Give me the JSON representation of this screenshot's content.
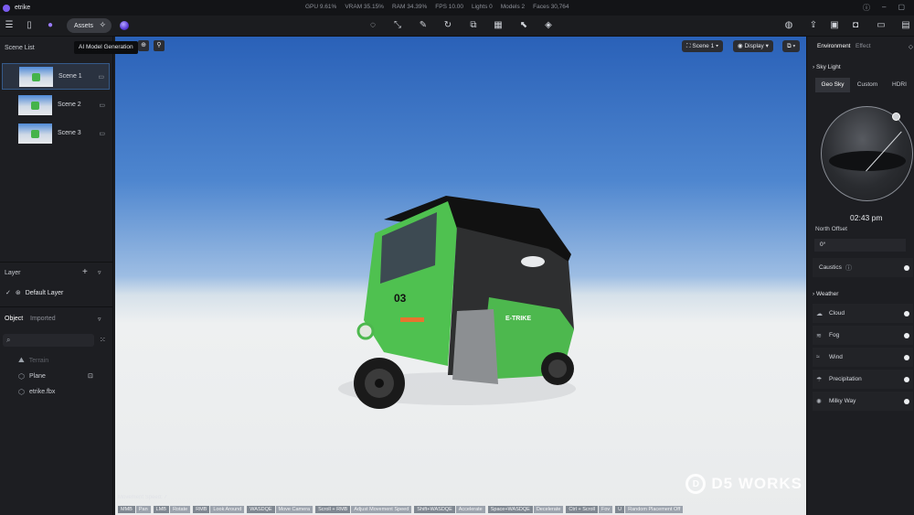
{
  "app": {
    "title": "etrike"
  },
  "stats": [
    "GPU 9.61%",
    "VRAM 35.15%",
    "RAM 34.39%",
    "FPS 10.00",
    "Lights 0",
    "Models 2",
    "Faces 30,764"
  ],
  "toolbar": {
    "assets_label": "Assets",
    "tooltip": "AI Model Generation"
  },
  "left_panel": {
    "scene_list_title": "Scene List",
    "scenes": [
      {
        "label": "Scene 1"
      },
      {
        "label": "Scene 2"
      },
      {
        "label": "Scene 3"
      }
    ],
    "layer_title": "Layer",
    "default_layer": "Default Layer",
    "object_tab": "Object",
    "imported_tab": "Imported",
    "objects": [
      {
        "label": "Terrain"
      },
      {
        "label": "Plane"
      },
      {
        "label": "etrike.fbx"
      }
    ]
  },
  "viewport": {
    "scene_selector": "Scene 1",
    "display_label": "Display",
    "movement_speed": "Movement Speed: 7",
    "shortcuts": [
      {
        "key": "MMB",
        "action": "Pan"
      },
      {
        "key": "LMB",
        "action": "Rotate"
      },
      {
        "key": "RMB",
        "action": "Look Around"
      },
      {
        "key": "WASDQE",
        "action": "Move Camera"
      },
      {
        "key": "Scroll + RMB",
        "action": "Adjust Movement Speed"
      },
      {
        "key": "Shift+WASDQE",
        "action": "Accelerate"
      },
      {
        "key": "Space+WASDQE",
        "action": "Decelerate"
      },
      {
        "key": "Ctrl + Scroll",
        "action": "Fov"
      },
      {
        "key": "U",
        "action": "Random Placement Off"
      }
    ],
    "vehicle_plate": "03",
    "vehicle_brand": "E-TRIKE",
    "watermark": "D5 WORKS"
  },
  "right_panel": {
    "tabs": [
      "Environment",
      "Effect"
    ],
    "sky_light_title": "Sky Light",
    "sky_tabs": [
      "Geo Sky",
      "Custom",
      "HDRI"
    ],
    "time": "02:43 pm",
    "north_offset_label": "North Offset",
    "north_offset_value": "0°",
    "caustics_label": "Caustics",
    "weather_title": "Weather",
    "weather_items": [
      {
        "label": "Cloud"
      },
      {
        "label": "Fog"
      },
      {
        "label": "Wind"
      },
      {
        "label": "Precipitation"
      },
      {
        "label": "Milky Way"
      }
    ]
  },
  "colors": {
    "accent": "#7b5cf0",
    "panel": "#1d1e22",
    "vehicle_green": "#45b34a"
  }
}
